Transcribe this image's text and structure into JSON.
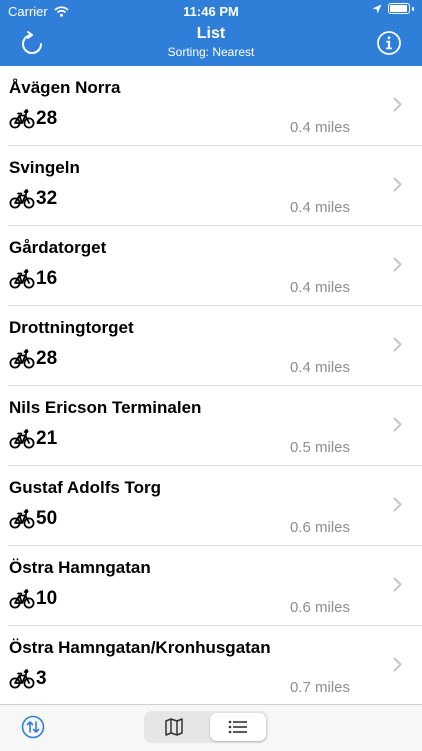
{
  "status_bar": {
    "carrier": "Carrier",
    "time": "11:46 PM"
  },
  "nav": {
    "title": "List",
    "subtitle": "Sorting: Nearest",
    "refresh_icon": "refresh-icon",
    "info_icon": "info-icon"
  },
  "stations": [
    {
      "name": "Åvägen Norra",
      "bikes": "28",
      "distance": "0.4 miles"
    },
    {
      "name": "Svingeln",
      "bikes": "32",
      "distance": "0.4 miles"
    },
    {
      "name": "Gårdatorget",
      "bikes": "16",
      "distance": "0.4 miles"
    },
    {
      "name": "Drottningtorget",
      "bikes": "28",
      "distance": "0.4 miles"
    },
    {
      "name": "Nils Ericson Terminalen",
      "bikes": "21",
      "distance": "0.5 miles"
    },
    {
      "name": "Gustaf Adolfs Torg",
      "bikes": "50",
      "distance": "0.6 miles"
    },
    {
      "name": "Östra Hamngatan",
      "bikes": "10",
      "distance": "0.6 miles"
    },
    {
      "name": "Östra Hamngatan/Kronhusgatan",
      "bikes": "3",
      "distance": "0.7 miles"
    }
  ],
  "tab_bar": {
    "sort_icon": "sort-toggle-icon",
    "segments": [
      {
        "icon": "map-icon",
        "selected": false
      },
      {
        "icon": "list-icon",
        "selected": true
      }
    ]
  },
  "colors": {
    "accent": "#2f7fd9",
    "secondary_text": "#8e8e93",
    "chevron": "#c4c4c8"
  }
}
